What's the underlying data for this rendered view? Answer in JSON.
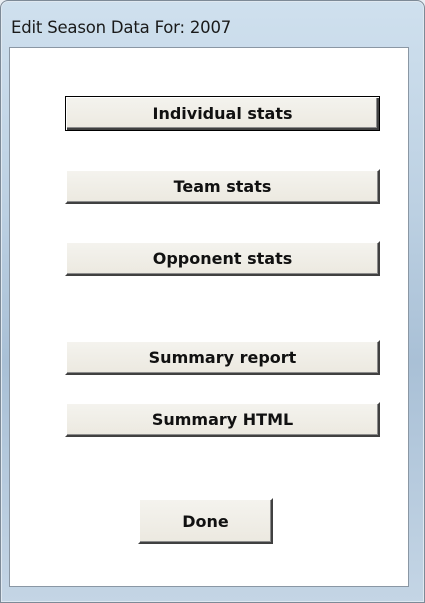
{
  "window": {
    "title": "Edit Season Data For: 2007"
  },
  "buttons": {
    "individual_stats": "Individual stats",
    "team_stats": "Team stats",
    "opponent_stats": "Opponent stats",
    "summary_report": "Summary report",
    "summary_html": "Summary HTML",
    "done": "Done"
  }
}
